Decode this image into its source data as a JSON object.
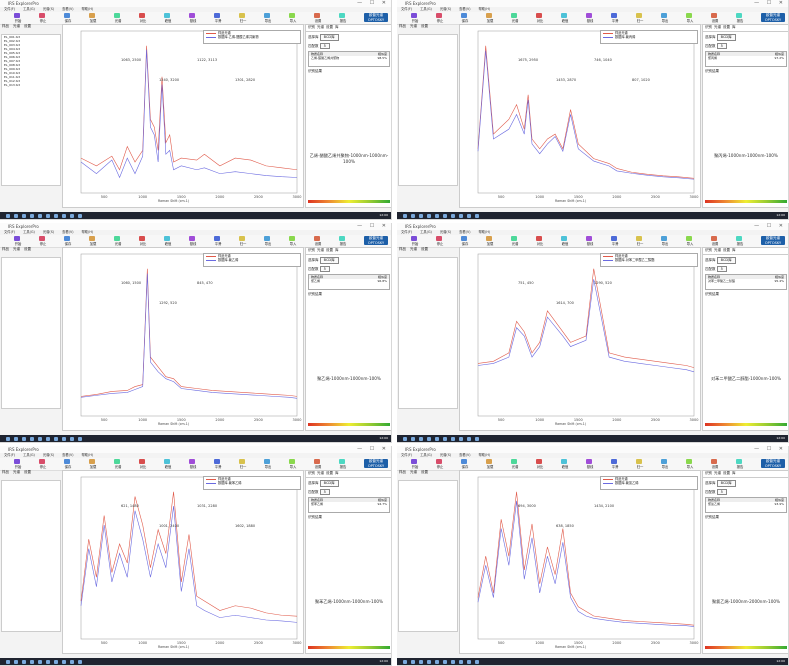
{
  "window": {
    "title": "IRS ExplorerPro",
    "menu": [
      "文件(F)",
      "工具(G)",
      "光谱(S)",
      "查看(V)",
      "帮助(H)"
    ],
    "controls": "— ☐ ✕"
  },
  "toolbar": {
    "buttons": [
      "开始",
      "停止",
      "保存",
      "加载",
      "光谱",
      "对比",
      "峰值",
      "基线",
      "平滑",
      "归一",
      "导出",
      "导入",
      "设置",
      "报告"
    ],
    "logo_line1": "欧普光谱",
    "logo_line2": "OPTOSKY"
  },
  "left_tabs": [
    "样品",
    "光谱",
    "设置"
  ],
  "right_tabs": [
    "识别",
    "光谱",
    "设置",
    "库"
  ],
  "right_panel": {
    "library_label": "选择库",
    "library_value": "BCD库",
    "match_label": "匹配数",
    "match_value": "5",
    "table_header_name": "物质名称",
    "table_header_score": "相似度",
    "ident_label": "识别结果"
  },
  "colors": {
    "series1": "#e05a4a",
    "series2": "#6a6ae0",
    "peak": "#7b1f6a",
    "accent": "#1d5fa8"
  },
  "panels": [
    {
      "left_list": [
        "EL_001.txt",
        "EL_002.txt",
        "EL_003.txt",
        "EL_004.txt",
        "EL_005.txt",
        "EL_006.txt",
        "EL_007.txt",
        "EL_008.txt",
        "EL_009.txt",
        "EL_010.txt",
        "EL_011.txt",
        "EL_012.txt",
        "EL_013.txt"
      ],
      "legend": [
        "样品光谱",
        "数据库-乙烯-醋酸乙烯共聚物"
      ],
      "table_row": "乙烯-醋酸乙烯共聚物",
      "table_score": "98.5%",
      "result": "乙烯-醋酸乙烯共聚物-1000nm-1000nm-100%",
      "chart_data": {
        "type": "line",
        "xlabel": "Raman Shift (cm-1)",
        "xlim": [
          200,
          3000
        ],
        "series": [
          {
            "name": "样品光谱",
            "x": [
              200,
              400,
              600,
              700,
              800,
              900,
              1000,
              1050,
              1100,
              1150,
              1200,
              1250,
              1300,
              1350,
              1400,
              1500,
              1700,
              1800,
              2000,
              2200,
              2400,
              2600,
              2800,
              3000
            ],
            "y": [
              900,
              700,
              950,
              600,
              1200,
              800,
              1100,
              3800,
              1900,
              1700,
              1100,
              3000,
              1300,
              1500,
              800,
              900,
              850,
              1000,
              700,
              900,
              850,
              700,
              650,
              600
            ]
          },
          {
            "name": "数据库-乙烯-醋酸乙烯共聚物",
            "x": [
              200,
              400,
              600,
              700,
              800,
              900,
              1000,
              1050,
              1100,
              1150,
              1200,
              1250,
              1300,
              1350,
              1400,
              1500,
              1700,
              1800,
              2000,
              2200,
              2400,
              2600,
              2800,
              3000
            ],
            "y": [
              800,
              500,
              850,
              400,
              900,
              500,
              950,
              3700,
              1700,
              1500,
              800,
              2800,
              1000,
              1100,
              600,
              700,
              600,
              650,
              500,
              550,
              500,
              450,
              420,
              400
            ]
          }
        ],
        "peak_labels": [
          "1063, 2500",
          "1240, 3200",
          "1122, 3113",
          "1301, 2820"
        ]
      }
    },
    {
      "left_list": [],
      "legend": [
        "样品光谱",
        "数据库-聚丙烯"
      ],
      "table_row": "聚丙烯",
      "table_score": "97.2%",
      "result": "聚丙烯-1000nm-1000nm-100%",
      "chart_data": {
        "type": "line",
        "xlabel": "Raman Shift (cm-1)",
        "xlim": [
          200,
          3000
        ],
        "series": [
          {
            "name": "样品光谱",
            "x": [
              200,
              300,
              400,
              600,
              700,
              800,
              850,
              900,
              1000,
              1100,
              1200,
              1300,
              1400,
              1500,
              1700,
              1900,
              2000,
              2200,
              2400,
              2600,
              2800,
              3000
            ],
            "y": [
              900,
              3000,
              1200,
              1500,
              1800,
              1300,
              2000,
              1100,
              900,
              1100,
              1200,
              900,
              1700,
              1000,
              700,
              600,
              500,
              420,
              380,
              350,
              330,
              300
            ]
          },
          {
            "name": "数据库-聚丙烯",
            "x": [
              200,
              300,
              400,
              600,
              700,
              800,
              850,
              900,
              1000,
              1100,
              1200,
              1300,
              1400,
              1500,
              1700,
              1900,
              2000,
              2200,
              2400,
              2600,
              2800,
              3000
            ],
            "y": [
              850,
              2900,
              1100,
              1300,
              1600,
              1200,
              1900,
              1000,
              800,
              1000,
              1150,
              850,
              1600,
              900,
              650,
              550,
              450,
              400,
              360,
              330,
              310,
              280
            ]
          }
        ],
        "peak_labels": [
          "1675, 2950",
          "1453, 2870",
          "746, 1040",
          "807, 1020"
        ]
      }
    },
    {
      "left_list": [],
      "legend": [
        "样品光谱",
        "数据库-聚乙烯"
      ],
      "table_row": "聚乙烯",
      "table_score": "96.8%",
      "result": "聚乙烯-1000nm-1000nm-100%",
      "chart_data": {
        "type": "line",
        "xlabel": "Raman Shift (cm-1)",
        "xlim": [
          200,
          3000
        ],
        "series": [
          {
            "name": "样品光谱",
            "x": [
              200,
              400,
              600,
              800,
              900,
              1000,
              1060,
              1100,
              1200,
              1300,
              1400,
              1500,
              1700,
              1900,
              2100,
              2300,
              2500,
              2700,
              2900,
              3000
            ],
            "y": [
              200,
              220,
              250,
              260,
              300,
              320,
              1500,
              600,
              500,
              400,
              380,
              300,
              280,
              260,
              250,
              240,
              230,
              220,
              210,
              200
            ]
          },
          {
            "name": "数据库-聚乙烯",
            "x": [
              200,
              400,
              600,
              800,
              900,
              1000,
              1060,
              1100,
              1200,
              1300,
              1400,
              1500,
              1700,
              1900,
              2100,
              2300,
              2500,
              2700,
              2900,
              3000
            ],
            "y": [
              190,
              210,
              230,
              240,
              270,
              300,
              1450,
              550,
              450,
              380,
              350,
              280,
              260,
              240,
              230,
              220,
              210,
              200,
              190,
              180
            ]
          }
        ],
        "peak_labels": [
          "1060, 1500",
          "1292, 520",
          "845, 470"
        ]
      }
    },
    {
      "left_list": [],
      "legend": [
        "样品光谱",
        "数据库-对苯二甲酸乙二醇酯"
      ],
      "table_row": "对苯二甲酸乙二醇酯",
      "table_score": "95.4%",
      "result": "对苯二甲酸乙二醇酯-1000nm-100%",
      "chart_data": {
        "type": "line",
        "xlabel": "Raman Shift (cm-1)",
        "xlim": [
          200,
          3000
        ],
        "series": [
          {
            "name": "样品光谱",
            "x": [
              200,
              400,
              600,
              700,
              800,
              900,
              1000,
              1100,
              1300,
              1400,
              1600,
              1700,
              1900,
              2100,
              2300,
              2500,
              2700,
              2900,
              3000
            ],
            "y": [
              250,
              260,
              300,
              450,
              400,
              300,
              350,
              500,
              400,
              350,
              380,
              700,
              300,
              280,
              270,
              260,
              250,
              240,
              230
            ]
          },
          {
            "name": "数据库-对苯二甲酸乙二醇酯",
            "x": [
              200,
              400,
              600,
              700,
              800,
              900,
              1000,
              1100,
              1300,
              1400,
              1600,
              1700,
              1900,
              2100,
              2300,
              2500,
              2700,
              2900,
              3000
            ],
            "y": [
              240,
              250,
              280,
              420,
              380,
              280,
              330,
              470,
              380,
              330,
              360,
              650,
              280,
              260,
              250,
              240,
              230,
              220,
              210
            ]
          }
        ],
        "peak_labels": [
          "751, 450",
          "1614, 700",
          "1290, 520"
        ]
      }
    },
    {
      "left_list": [],
      "legend": [
        "样品光谱",
        "数据库-聚苯乙烯"
      ],
      "table_row": "聚苯乙烯",
      "table_score": "94.7%",
      "result": "聚苯乙烯-1000nm-1000nm-100%",
      "chart_data": {
        "type": "line",
        "xlabel": "Raman Shift (cm-1)",
        "xlim": [
          200,
          3000
        ],
        "series": [
          {
            "name": "样品光谱",
            "x": [
              200,
              300,
              400,
              500,
              600,
              700,
              800,
              900,
              1000,
              1100,
              1200,
              1300,
              1400,
              1500,
              1600,
              1700,
              1800,
              2000,
              2200,
              2400,
              2600,
              2800,
              3000
            ],
            "y": [
              800,
              2100,
              1300,
              2600,
              1400,
              2000,
              1600,
              3000,
              2400,
              1500,
              2300,
              1800,
              3100,
              1200,
              2200,
              900,
              800,
              600,
              700,
              650,
              550,
              500,
              480
            ]
          },
          {
            "name": "数据库-聚苯乙烯",
            "x": [
              200,
              300,
              400,
              500,
              600,
              700,
              800,
              900,
              1000,
              1100,
              1200,
              1300,
              1400,
              1500,
              1600,
              1700,
              1800,
              2000,
              2200,
              2400,
              2600,
              2800,
              3000
            ],
            "y": [
              700,
              1900,
              1100,
              2400,
              1200,
              1800,
              1300,
              2700,
              2100,
              1300,
              2000,
              1500,
              2800,
              1000,
              1900,
              700,
              600,
              450,
              500,
              450,
              400,
              380,
              350
            ]
          }
        ],
        "peak_labels": [
          "621, 1480",
          "1001, 2400",
          "1031, 2280",
          "1602, 1880"
        ]
      }
    },
    {
      "left_list": [],
      "legend": [
        "样品光谱",
        "数据库-聚氯乙烯"
      ],
      "table_row": "聚氯乙烯",
      "table_score": "93.9%",
      "result": "聚氯乙烯-1000nm-2000nm-100%",
      "chart_data": {
        "type": "line",
        "xlabel": "Raman Shift (cm-1)",
        "xlim": [
          200,
          3000
        ],
        "series": [
          {
            "name": "样品光谱",
            "x": [
              200,
              300,
              400,
              500,
              600,
              700,
              800,
              900,
              1000,
              1100,
              1200,
              1300,
              1400,
              1500,
              1600,
              1700,
              1900,
              2100,
              2300,
              2500,
              2700,
              2900,
              3000
            ],
            "y": [
              900,
              1800,
              1000,
              2600,
              1800,
              3200,
              1500,
              2500,
              1200,
              2000,
              1400,
              2400,
              1000,
              700,
              600,
              500,
              450,
              400,
              380,
              360,
              340,
              320,
              300
            ]
          },
          {
            "name": "数据库-聚氯乙烯",
            "x": [
              200,
              300,
              400,
              500,
              600,
              700,
              800,
              900,
              1000,
              1100,
              1200,
              1300,
              1400,
              1500,
              1600,
              1700,
              1900,
              2100,
              2300,
              2500,
              2700,
              2900,
              3000
            ],
            "y": [
              800,
              1600,
              900,
              2400,
              1600,
              3000,
              1300,
              2200,
              1000,
              1800,
              1200,
              2100,
              900,
              600,
              500,
              450,
              400,
              360,
              340,
              320,
              300,
              290,
              270
            ]
          }
        ],
        "peak_labels": [
          "694, 3000",
          "638, 1850",
          "1434, 2100"
        ]
      }
    }
  ]
}
